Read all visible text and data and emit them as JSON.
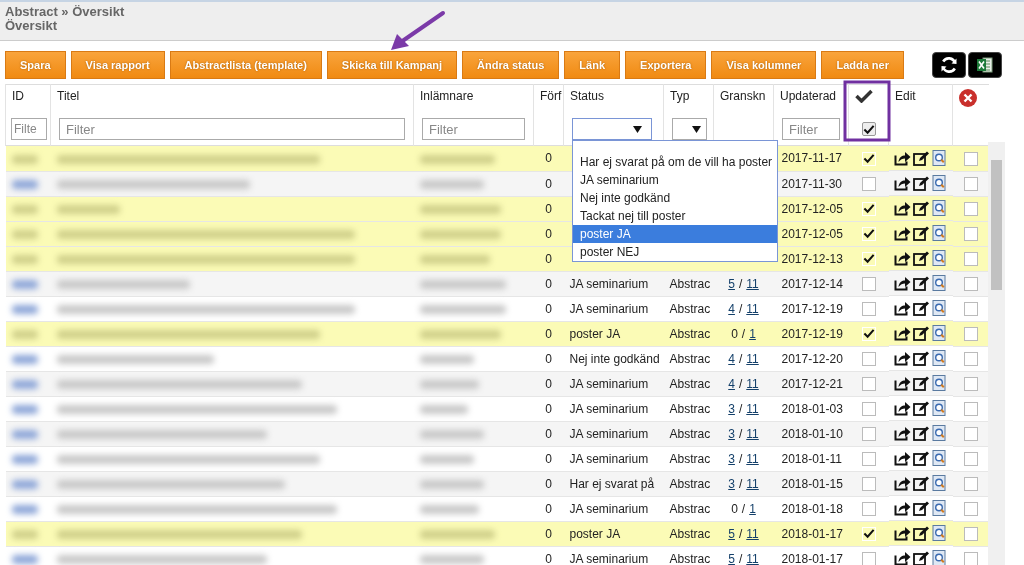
{
  "breadcrumb": "Abstract » Översikt",
  "page_title": "Översikt",
  "toolbar": {
    "buttons": [
      "Spara",
      "Visa rapport",
      "Abstractlista (template)",
      "Skicka till Kampanj",
      "Ändra status",
      "Länk",
      "Exportera",
      "Visa kolumner",
      "Ladda ner"
    ]
  },
  "table": {
    "review_separator": "/",
    "columns": [
      {
        "kind": "text",
        "label": "ID",
        "filter": {
          "kind": "text",
          "placeholder": "Filte"
        }
      },
      {
        "kind": "text",
        "label": "Titel",
        "filter": {
          "kind": "text",
          "placeholder": "Filter"
        }
      },
      {
        "kind": "text",
        "label": "Inlämnare",
        "filter": {
          "kind": "text",
          "placeholder": "Filter"
        }
      },
      {
        "kind": "text",
        "label": "Förf"
      },
      {
        "kind": "text",
        "label": "Status",
        "filter": {
          "kind": "select",
          "open": true
        }
      },
      {
        "kind": "text",
        "label": "Typ",
        "filter": {
          "kind": "select",
          "open": false
        }
      },
      {
        "kind": "text",
        "label": "Granskn"
      },
      {
        "kind": "text",
        "label": "Updaterad",
        "filter": {
          "kind": "text",
          "placeholder": "Filter"
        }
      },
      {
        "kind": "check",
        "filter": {
          "kind": "checkbox",
          "checked": true
        }
      },
      {
        "kind": "text",
        "label": "Edit"
      },
      {
        "kind": "delete"
      }
    ],
    "rows": [
      {
        "forf": "0",
        "updated": "2017-11-17",
        "checked": true,
        "marked": false
      },
      {
        "forf": "0",
        "updated": "2017-11-30",
        "checked": false,
        "marked": false
      },
      {
        "forf": "0",
        "updated": "2017-12-05",
        "checked": true,
        "marked": false
      },
      {
        "forf": "0",
        "updated": "2017-12-05",
        "checked": true,
        "marked": false
      },
      {
        "forf": "0",
        "updated": "2017-12-13",
        "checked": true,
        "marked": false
      },
      {
        "forf": "0",
        "status": "JA seminarium",
        "type": "Abstrac",
        "review_done": "5",
        "review_done_link": true,
        "review_total": "11",
        "updated": "2017-12-14",
        "checked": false,
        "marked": false
      },
      {
        "forf": "0",
        "status": "JA seminarium",
        "type": "Abstrac",
        "review_done": "4",
        "review_done_link": true,
        "review_total": "11",
        "updated": "2017-12-19",
        "checked": false,
        "marked": false
      },
      {
        "forf": "0",
        "status": "poster JA",
        "type": "Abstrac",
        "review_done": "0",
        "review_done_link": false,
        "review_total": "1",
        "updated": "2017-12-19",
        "checked": true,
        "marked": false
      },
      {
        "forf": "0",
        "status": "Nej inte godkänd",
        "type": "Abstrac",
        "review_done": "4",
        "review_done_link": true,
        "review_total": "11",
        "updated": "2017-12-20",
        "checked": false,
        "marked": false
      },
      {
        "forf": "0",
        "status": "JA seminarium",
        "type": "Abstrac",
        "review_done": "4",
        "review_done_link": true,
        "review_total": "11",
        "updated": "2017-12-21",
        "checked": false,
        "marked": false
      },
      {
        "forf": "0",
        "status": "JA seminarium",
        "type": "Abstrac",
        "review_done": "3",
        "review_done_link": true,
        "review_total": "11",
        "updated": "2018-01-03",
        "checked": false,
        "marked": false
      },
      {
        "forf": "0",
        "status": "JA seminarium",
        "type": "Abstrac",
        "review_done": "3",
        "review_done_link": true,
        "review_total": "11",
        "updated": "2018-01-10",
        "checked": false,
        "marked": false
      },
      {
        "forf": "0",
        "status": "JA seminarium",
        "type": "Abstrac",
        "review_done": "3",
        "review_done_link": true,
        "review_total": "11",
        "updated": "2018-01-11",
        "checked": false,
        "marked": false
      },
      {
        "forf": "0",
        "status": "Har ej svarat på",
        "type": "Abstrac",
        "review_done": "3",
        "review_done_link": true,
        "review_total": "11",
        "updated": "2018-01-15",
        "checked": false,
        "marked": false
      },
      {
        "forf": "0",
        "status": "JA seminarium",
        "type": "Abstrac",
        "review_done": "0",
        "review_done_link": false,
        "review_total": "1",
        "updated": "2018-01-18",
        "checked": false,
        "marked": false
      },
      {
        "forf": "0",
        "status": "poster JA",
        "type": "Abstrac",
        "review_done": "5",
        "review_done_link": true,
        "review_total": "11",
        "updated": "2018-01-17",
        "checked": true,
        "marked": false
      },
      {
        "forf": "0",
        "status": "JA seminarium",
        "type": "Abstrac",
        "review_done": "5",
        "review_done_link": true,
        "review_total": "11",
        "updated": "2018-01-17",
        "checked": false,
        "marked": false
      }
    ]
  },
  "status_dropdown": {
    "options": [
      {
        "label": "Har ej svarat på om de vill ha poster",
        "selected": false
      },
      {
        "label": "JA seminarium",
        "selected": false
      },
      {
        "label": "Nej inte godkänd",
        "selected": false
      },
      {
        "label": "Tackat nej till poster",
        "selected": false
      },
      {
        "label": "poster JA",
        "selected": true
      },
      {
        "label": "poster NEJ",
        "selected": false
      }
    ]
  }
}
